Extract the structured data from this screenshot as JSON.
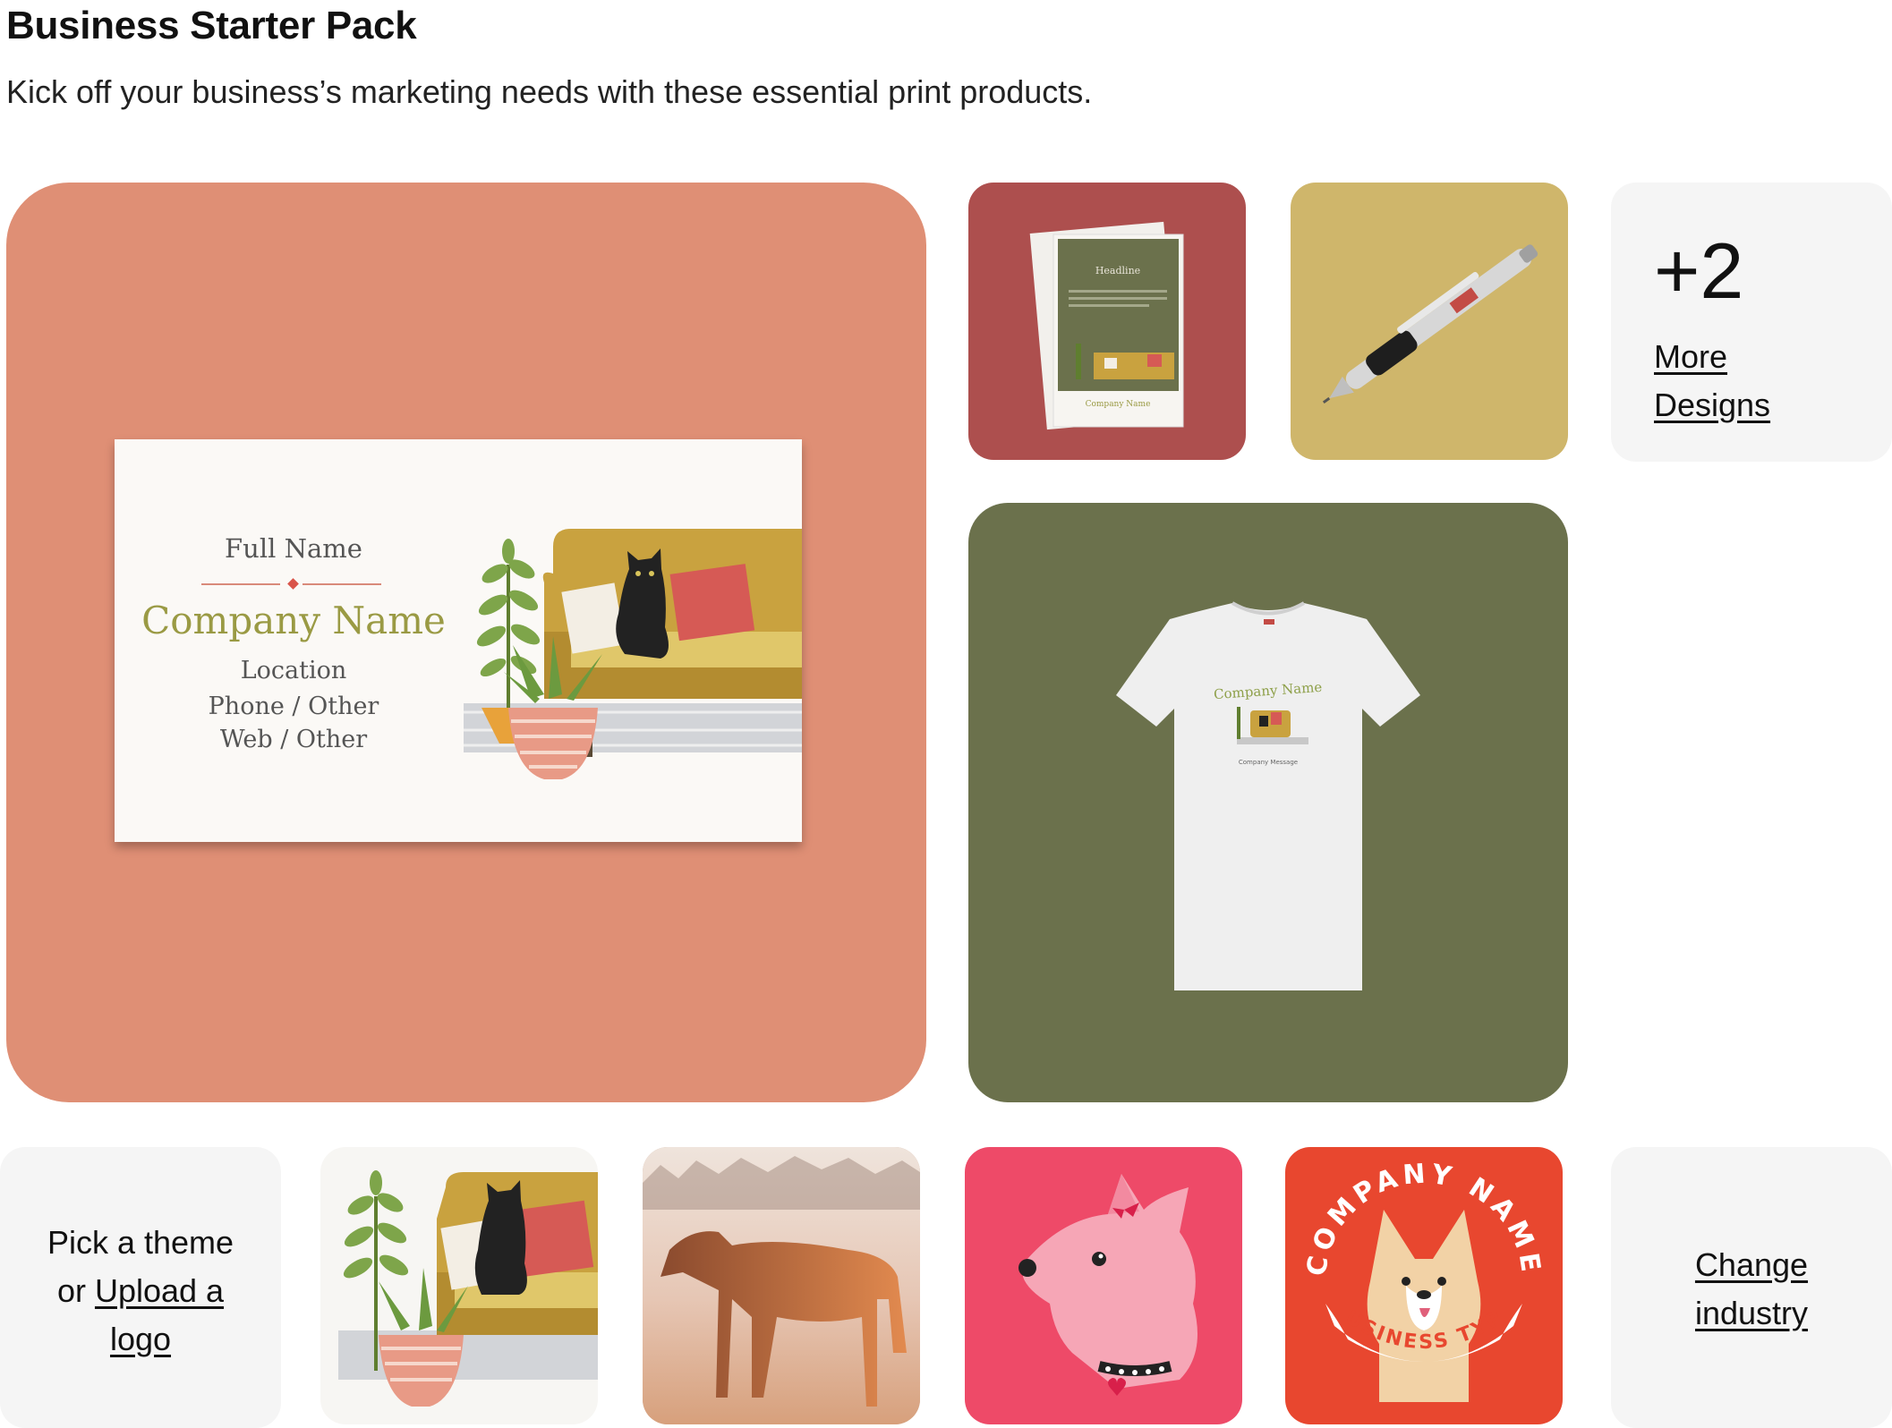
{
  "header": {
    "title": "Business Starter Pack",
    "subtitle": "Kick off your business’s marketing needs with these essential print products."
  },
  "business_card": {
    "full_name": "Full Name",
    "company_name": "Company Name",
    "location": "Location",
    "phone": "Phone / Other",
    "web": "Web / Other"
  },
  "flyer": {
    "headline": "Headline",
    "company": "Company Name"
  },
  "tshirt": {
    "company": "Company Name",
    "message": "Company Message"
  },
  "more_designs": {
    "count": "+2",
    "link_line1": "More",
    "link_line2": "Designs"
  },
  "theme_picker": {
    "line1": "Pick a theme",
    "line2_prefix": "or ",
    "line2_link": "Upload a",
    "line3_link": "logo"
  },
  "logo_badge": {
    "top_text": "COMPANY NAME",
    "bottom_text": "BUSINESS TYPE"
  },
  "change_industry": {
    "line1": "Change",
    "line2": "industry"
  },
  "colors": {
    "hero_bg": "#df8f75",
    "flyer_bg": "#ad4f4e",
    "pen_bg": "#cfb66b",
    "shirt_bg": "#6b714c",
    "light_tile_bg": "#f5f5f5",
    "dog_bg": "#ee4a68",
    "badge_bg": "#e8472f"
  },
  "icons": [
    "cat-sofa-illustration",
    "pen-product",
    "tshirt-product",
    "horse-photo",
    "dog-icon",
    "corgi-badge"
  ]
}
